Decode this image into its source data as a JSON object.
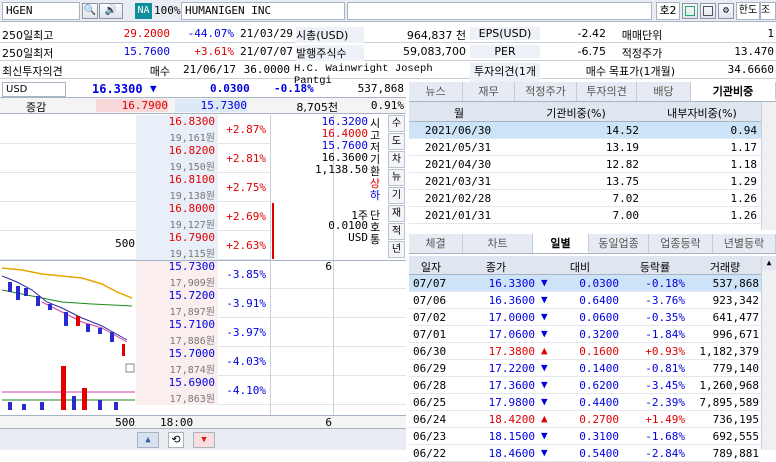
{
  "toolbar": {
    "ticker": "HGEN",
    "na_label": "NA",
    "zoom": "100%",
    "company": "HUMANIGEN INC",
    "slot": "호2",
    "lang_button": "한도",
    "query_button": "조회"
  },
  "summary": {
    "rows": [
      {
        "label": "250일최고",
        "price": "29.2000",
        "pct": "-44.07%",
        "date": "21/03/29",
        "k1": "시총(USD)",
        "v1": "964,837 천",
        "k2": "EPS(USD)",
        "v2": "-2.42",
        "k3": "매매단위",
        "v3": "1"
      },
      {
        "label": "250일최저",
        "price": "15.7600",
        "pct": "+3.61%",
        "date": "21/07/07",
        "k1": "발행주식수",
        "v1": "59,083,700",
        "k2": "PER",
        "v2": "-6.75",
        "k3": "적정주가",
        "v3": "13.470"
      },
      {
        "label": "최신투자의견",
        "price": "매수",
        "pct": "21/06/17",
        "date": "36.0000",
        "k1": "H.C. Wainwright Joseph Pantgi",
        "v1": "",
        "k2": "투자의견(1개월)",
        "v2": "매수",
        "k3": "목표가(1개월)",
        "v3": "34.6660"
      }
    ]
  },
  "quote": {
    "currency": "USD",
    "price": "16.3300",
    "arrow": "▼",
    "change": "0.0300",
    "change_pct": "-0.18%",
    "volume": "537,868",
    "increase_label": "증감",
    "ask1": "16.7900",
    "bid1": "15.7300",
    "trade_value": "8,705천",
    "ratio": "0.91%"
  },
  "orderbook": {
    "asks": [
      {
        "price": "16.8300",
        "krw": "19,161원",
        "pct": "+2.87%",
        "qty": ""
      },
      {
        "price": "16.8200",
        "krw": "19,150원",
        "pct": "+2.81%",
        "qty": ""
      },
      {
        "price": "16.8100",
        "krw": "19,138원",
        "pct": "+2.75%",
        "qty": ""
      },
      {
        "price": "16.8000",
        "krw": "19,127원",
        "pct": "+2.69%",
        "qty": ""
      },
      {
        "price": "16.7900",
        "krw": "19,115원",
        "pct": "+2.63%",
        "qty": "500"
      }
    ],
    "bids": [
      {
        "price": "15.7300",
        "krw": "17,909원",
        "pct": "-3.85%",
        "qty": "6"
      },
      {
        "price": "15.7200",
        "krw": "17,897원",
        "pct": "-3.91%",
        "qty": ""
      },
      {
        "price": "15.7100",
        "krw": "17,886원",
        "pct": "-3.97%",
        "qty": ""
      },
      {
        "price": "15.7000",
        "krw": "17,874원",
        "pct": "-4.03%",
        "qty": ""
      },
      {
        "price": "15.6900",
        "krw": "17,863원",
        "pct": "-4.10%",
        "qty": ""
      }
    ],
    "ohlc": [
      "16.3200",
      "16.4000",
      "15.7600",
      "16.3600",
      "1,138.50"
    ],
    "ohlc_labels": [
      "시",
      "고",
      "저",
      "기",
      "환"
    ],
    "ohlc_state": "상",
    "ohlc_state2": "하",
    "unit_lines": [
      "1주",
      "0.0100",
      "USD"
    ],
    "unit_labels": [
      "단",
      "호",
      "통"
    ],
    "side_tabs": [
      "수",
      "도",
      "차",
      "뉴",
      "기",
      "재",
      "적",
      "년"
    ],
    "total_ask": "500",
    "time": "18:00",
    "total_bid": "6"
  },
  "right_tabs_top": [
    "뉴스",
    "재무",
    "적정주가",
    "투자의견",
    "배당",
    "기관비중"
  ],
  "inst_table": {
    "headers": [
      "월",
      "기관비중(%)",
      "내부자비중(%)"
    ],
    "rows": [
      [
        "2021/06/30",
        "14.52",
        "0.94"
      ],
      [
        "2021/05/31",
        "13.19",
        "1.17"
      ],
      [
        "2021/04/30",
        "12.82",
        "1.18"
      ],
      [
        "2021/03/31",
        "13.75",
        "1.29"
      ],
      [
        "2021/02/28",
        "7.02",
        "1.26"
      ],
      [
        "2021/01/31",
        "7.00",
        "1.26"
      ]
    ]
  },
  "right_tabs_bottom": [
    "체결",
    "차트",
    "일별",
    "동일업종",
    "업종등락",
    "년별등락"
  ],
  "daily_table": {
    "headers": [
      "일자",
      "종가",
      "대비",
      "등락률",
      "거래량"
    ],
    "rows": [
      {
        "date": "07/07",
        "close": "16.3300",
        "dir": "down",
        "diff": "0.0300",
        "pct": "-0.18%",
        "vol": "537,868"
      },
      {
        "date": "07/06",
        "close": "16.3600",
        "dir": "down",
        "diff": "0.6400",
        "pct": "-3.76%",
        "vol": "923,342"
      },
      {
        "date": "07/02",
        "close": "17.0000",
        "dir": "down",
        "diff": "0.0600",
        "pct": "-0.35%",
        "vol": "641,477"
      },
      {
        "date": "07/01",
        "close": "17.0600",
        "dir": "down",
        "diff": "0.3200",
        "pct": "-1.84%",
        "vol": "996,671"
      },
      {
        "date": "06/30",
        "close": "17.3800",
        "dir": "up",
        "diff": "0.1600",
        "pct": "+0.93%",
        "vol": "1,182,379"
      },
      {
        "date": "06/29",
        "close": "17.2200",
        "dir": "down",
        "diff": "0.1400",
        "pct": "-0.81%",
        "vol": "779,140"
      },
      {
        "date": "06/28",
        "close": "17.3600",
        "dir": "down",
        "diff": "0.6200",
        "pct": "-3.45%",
        "vol": "1,260,968"
      },
      {
        "date": "06/25",
        "close": "17.9800",
        "dir": "down",
        "diff": "0.4400",
        "pct": "-2.39%",
        "vol": "7,895,589"
      },
      {
        "date": "06/24",
        "close": "18.4200",
        "dir": "up",
        "diff": "0.2700",
        "pct": "+1.49%",
        "vol": "736,195"
      },
      {
        "date": "06/23",
        "close": "18.1500",
        "dir": "down",
        "diff": "0.3100",
        "pct": "-1.68%",
        "vol": "692,555"
      },
      {
        "date": "06/22",
        "close": "18.4600",
        "dir": "down",
        "diff": "0.5400",
        "pct": "-2.84%",
        "vol": "789,881"
      }
    ]
  },
  "colors": {
    "up": "#e00000",
    "down": "#0000e0",
    "ask_bg": "#e8eff8",
    "bid_bg": "#fbeeee",
    "selected": "#cde3f7"
  }
}
